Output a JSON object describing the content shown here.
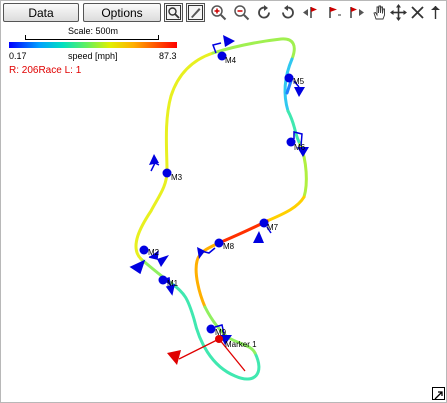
{
  "toolbar": {
    "data_label": "Data",
    "options_label": "Options",
    "tools": [
      "zoom-region-icon",
      "draw-icon",
      "zoom-in-icon",
      "zoom-out-icon",
      "rotate-cw-icon",
      "rotate-ccw-icon",
      "previous-marker-icon",
      "first-marker-icon",
      "next-marker-icon",
      "pan-hand-icon",
      "move-icon"
    ]
  },
  "scale": {
    "label": "Scale: 500m"
  },
  "colorbar": {
    "min": "0.17",
    "label": "speed [mph]",
    "max": "87.3"
  },
  "run_info": "R: 206Race  L: 1",
  "markers": [
    {
      "label": "M1"
    },
    {
      "label": "M2"
    },
    {
      "label": "M3"
    },
    {
      "label": "M4"
    },
    {
      "label": "M5"
    },
    {
      "label": "M6"
    },
    {
      "label": "M7"
    },
    {
      "label": "M8"
    },
    {
      "label": "M9"
    }
  ],
  "active_marker": {
    "label": "Marker 1"
  },
  "colors": {
    "marker_blue": "#0000e0",
    "active_red": "#e00000",
    "text_red": "#e00000"
  }
}
